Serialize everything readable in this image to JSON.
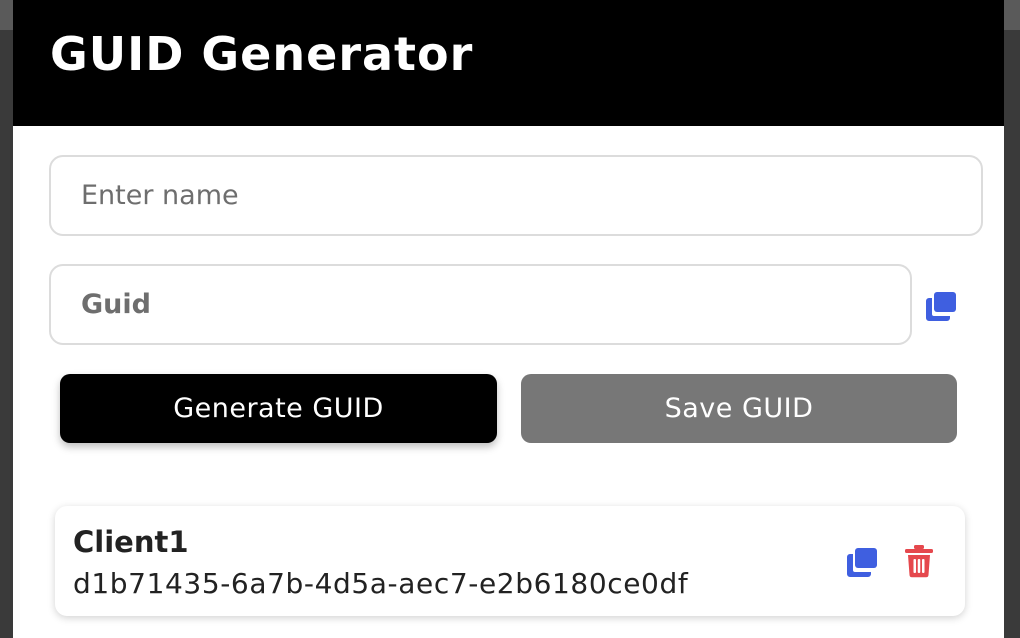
{
  "header": {
    "title": "GUID Generator"
  },
  "form": {
    "name_placeholder": "Enter name",
    "name_value": "",
    "guid_placeholder": "Guid",
    "guid_value": ""
  },
  "buttons": {
    "generate_label": "Generate GUID",
    "save_label": "Save GUID"
  },
  "saved_guids": [
    {
      "name": "Client1",
      "guid": "d1b71435-6a7b-4d5a-aec7-e2b6180ce0df"
    }
  ],
  "icons": {
    "copy": "copy-icon",
    "delete": "trash-icon"
  },
  "colors": {
    "header_bg": "#000000",
    "copy_icon": "#3f5fe0",
    "delete_icon": "#e5484d",
    "save_button_bg": "#777777",
    "generate_button_bg": "#000000"
  }
}
